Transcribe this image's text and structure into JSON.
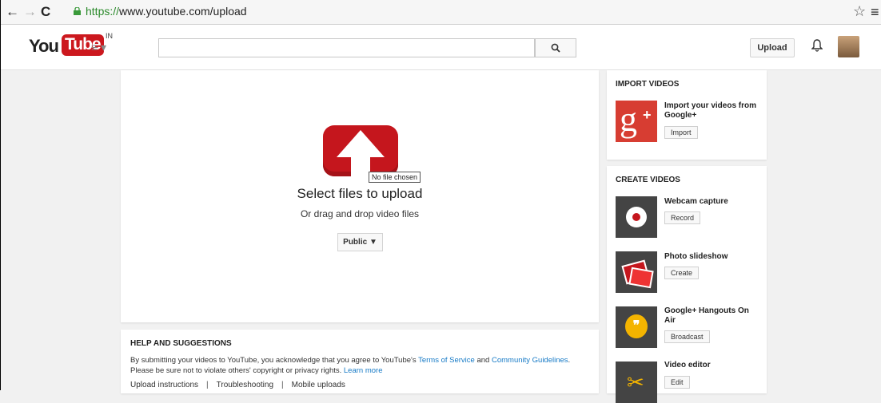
{
  "browser": {
    "back": "←",
    "forward": "→",
    "reload": "C",
    "url_scheme": "https://",
    "url_rest": "www.youtube.com/upload",
    "star": "☆",
    "menu": "≡"
  },
  "header": {
    "logo_you": "You",
    "logo_tube": "Tube",
    "logo_region": "IN",
    "guide": "≡ ▾",
    "search_placeholder": "",
    "search_icon": "🔍︎",
    "upload_label": "Upload",
    "bell_icon": "🔔︎"
  },
  "upload": {
    "tooltip": "No file chosen",
    "title": "Select files to upload",
    "subtitle": "Or drag and drop video files",
    "privacy_value": "Public ▼"
  },
  "help": {
    "title": "HELP AND SUGGESTIONS",
    "text_1": "By submitting your videos to YouTube, you acknowledge that you agree to YouTube's ",
    "terms_link": "Terms of Service",
    "text_and": " and ",
    "guidelines_link": "Community Guidelines",
    "text_2": ". Please be sure not to violate others' copyright or privacy rights. ",
    "learn_more": "Learn more",
    "links": [
      "Upload instructions",
      "Troubleshooting",
      "Mobile uploads"
    ]
  },
  "import": {
    "title": "IMPORT VIDEOS",
    "item_label": "Import your videos from Google+",
    "button": "Import"
  },
  "create": {
    "title": "CREATE VIDEOS",
    "items": [
      {
        "label": "Webcam capture",
        "button": "Record"
      },
      {
        "label": "Photo slideshow",
        "button": "Create"
      },
      {
        "label": "Google+ Hangouts On Air",
        "button": "Broadcast"
      },
      {
        "label": "Video editor",
        "button": "Edit"
      }
    ]
  },
  "colors": {
    "brand_red": "#cc181e",
    "link_blue": "#167ac6",
    "gplus_red": "#d73d32",
    "hangouts_yellow": "#f4b400"
  }
}
